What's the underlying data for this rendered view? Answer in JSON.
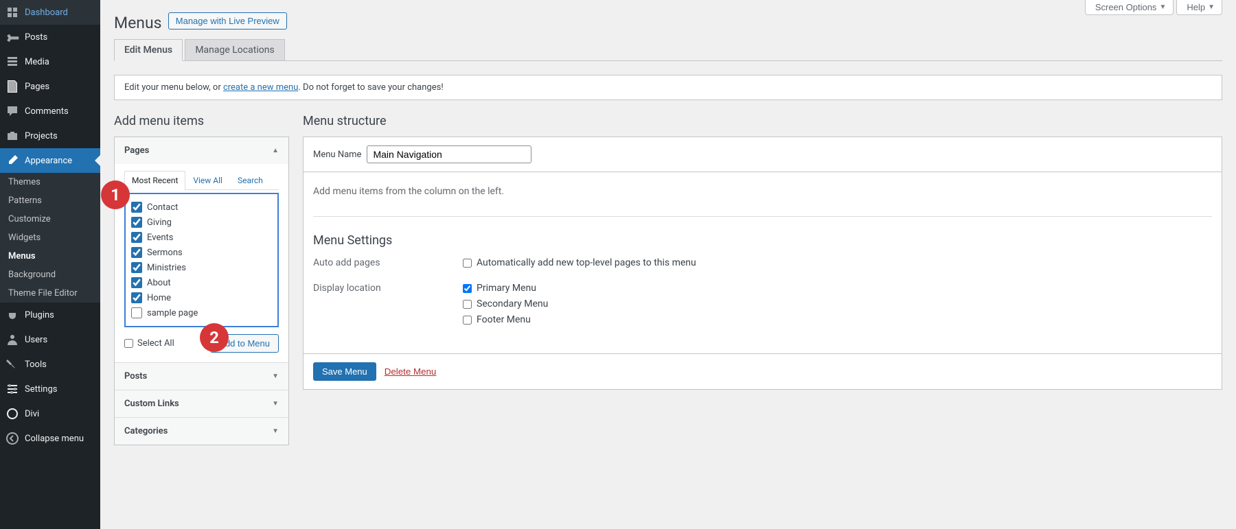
{
  "sidebar": {
    "items": [
      {
        "icon": "dashboard",
        "label": "Dashboard"
      },
      {
        "icon": "pin",
        "label": "Posts"
      },
      {
        "icon": "media",
        "label": "Media"
      },
      {
        "icon": "page",
        "label": "Pages"
      },
      {
        "icon": "comment",
        "label": "Comments"
      },
      {
        "icon": "portfolio",
        "label": "Projects"
      },
      {
        "icon": "brush",
        "label": "Appearance",
        "active": true
      },
      {
        "icon": "plug",
        "label": "Plugins"
      },
      {
        "icon": "user",
        "label": "Users"
      },
      {
        "icon": "wrench",
        "label": "Tools"
      },
      {
        "icon": "sliders",
        "label": "Settings"
      },
      {
        "icon": "circle",
        "label": "Divi"
      }
    ],
    "submenu": [
      "Themes",
      "Patterns",
      "Customize",
      "Widgets",
      "Menus",
      "Background",
      "Theme File Editor"
    ],
    "collapse": "Collapse menu"
  },
  "top": {
    "screen_options": "Screen Options",
    "help": "Help"
  },
  "header": {
    "title": "Menus",
    "action": "Manage with Live Preview"
  },
  "tabs": {
    "edit": "Edit Menus",
    "locations": "Manage Locations"
  },
  "notice": {
    "pre": "Edit your menu below, or ",
    "link": "create a new menu",
    "post": ". Do not forget to save your changes!"
  },
  "left": {
    "heading": "Add menu items",
    "pages": {
      "title": "Pages",
      "inner_tabs": [
        "Most Recent",
        "View All",
        "Search"
      ],
      "items": [
        {
          "label": "Contact",
          "checked": true
        },
        {
          "label": "Giving",
          "checked": true
        },
        {
          "label": "Events",
          "checked": true
        },
        {
          "label": "Sermons",
          "checked": true
        },
        {
          "label": "Ministries",
          "checked": true
        },
        {
          "label": "About",
          "checked": true
        },
        {
          "label": "Home",
          "checked": true
        },
        {
          "label": "sample page",
          "checked": false
        }
      ],
      "select_all": "Select All",
      "add_btn": "Add to Menu"
    },
    "sections": [
      "Posts",
      "Custom Links",
      "Categories"
    ]
  },
  "right": {
    "heading": "Menu structure",
    "name_label": "Menu Name",
    "name_value": "Main Navigation",
    "empty": "Add menu items from the column on the left.",
    "settings_title": "Menu Settings",
    "auto_add": {
      "label": "Auto add pages",
      "opt": "Automatically add new top-level pages to this menu"
    },
    "display": {
      "label": "Display location",
      "opts": [
        {
          "label": "Primary Menu",
          "checked": true
        },
        {
          "label": "Secondary Menu",
          "checked": false
        },
        {
          "label": "Footer Menu",
          "checked": false
        }
      ]
    },
    "save": "Save Menu",
    "delete": "Delete Menu"
  },
  "markers": {
    "one": "1",
    "two": "2"
  }
}
